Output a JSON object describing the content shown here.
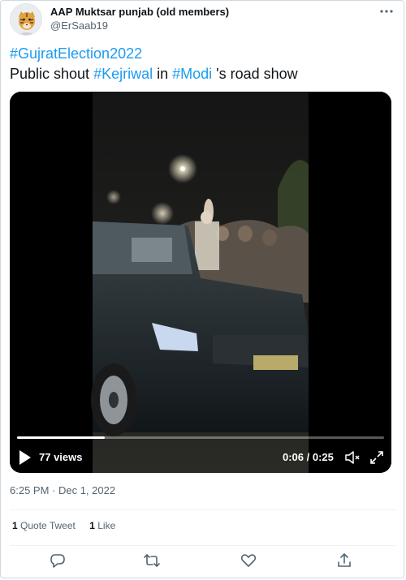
{
  "author": {
    "name": "AAP Muktsar punjab (old members)",
    "handle": "@ErSaab19",
    "avatar_icon": "tiger-avatar-icon"
  },
  "tweet": {
    "line1": [
      {
        "text": "#GujratElection2022",
        "type": "hashtag"
      }
    ],
    "line2": [
      {
        "text": "Public shout ",
        "type": "text"
      },
      {
        "text": "#Kejriwal",
        "type": "hashtag"
      },
      {
        "text": " in ",
        "type": "text"
      },
      {
        "text": "#Modi",
        "type": "hashtag"
      },
      {
        "text": " 's road show",
        "type": "text"
      }
    ]
  },
  "video": {
    "views": "77 views",
    "time": "0:06 / 0:25",
    "progress": 0.24,
    "icons": [
      "play-icon",
      "volume-muted-icon",
      "fullscreen-icon"
    ]
  },
  "timestamp": "6:25 PM · Dec 1, 2022",
  "stats": {
    "quote_count": "1",
    "quote_label": "Quote Tweet",
    "like_count": "1",
    "like_label": "Like"
  },
  "actions": [
    "reply-icon",
    "retweet-icon",
    "like-icon",
    "share-icon"
  ],
  "colors": {
    "accent": "#1d9bf0",
    "text": "#0f1419",
    "secondary": "#536471"
  }
}
